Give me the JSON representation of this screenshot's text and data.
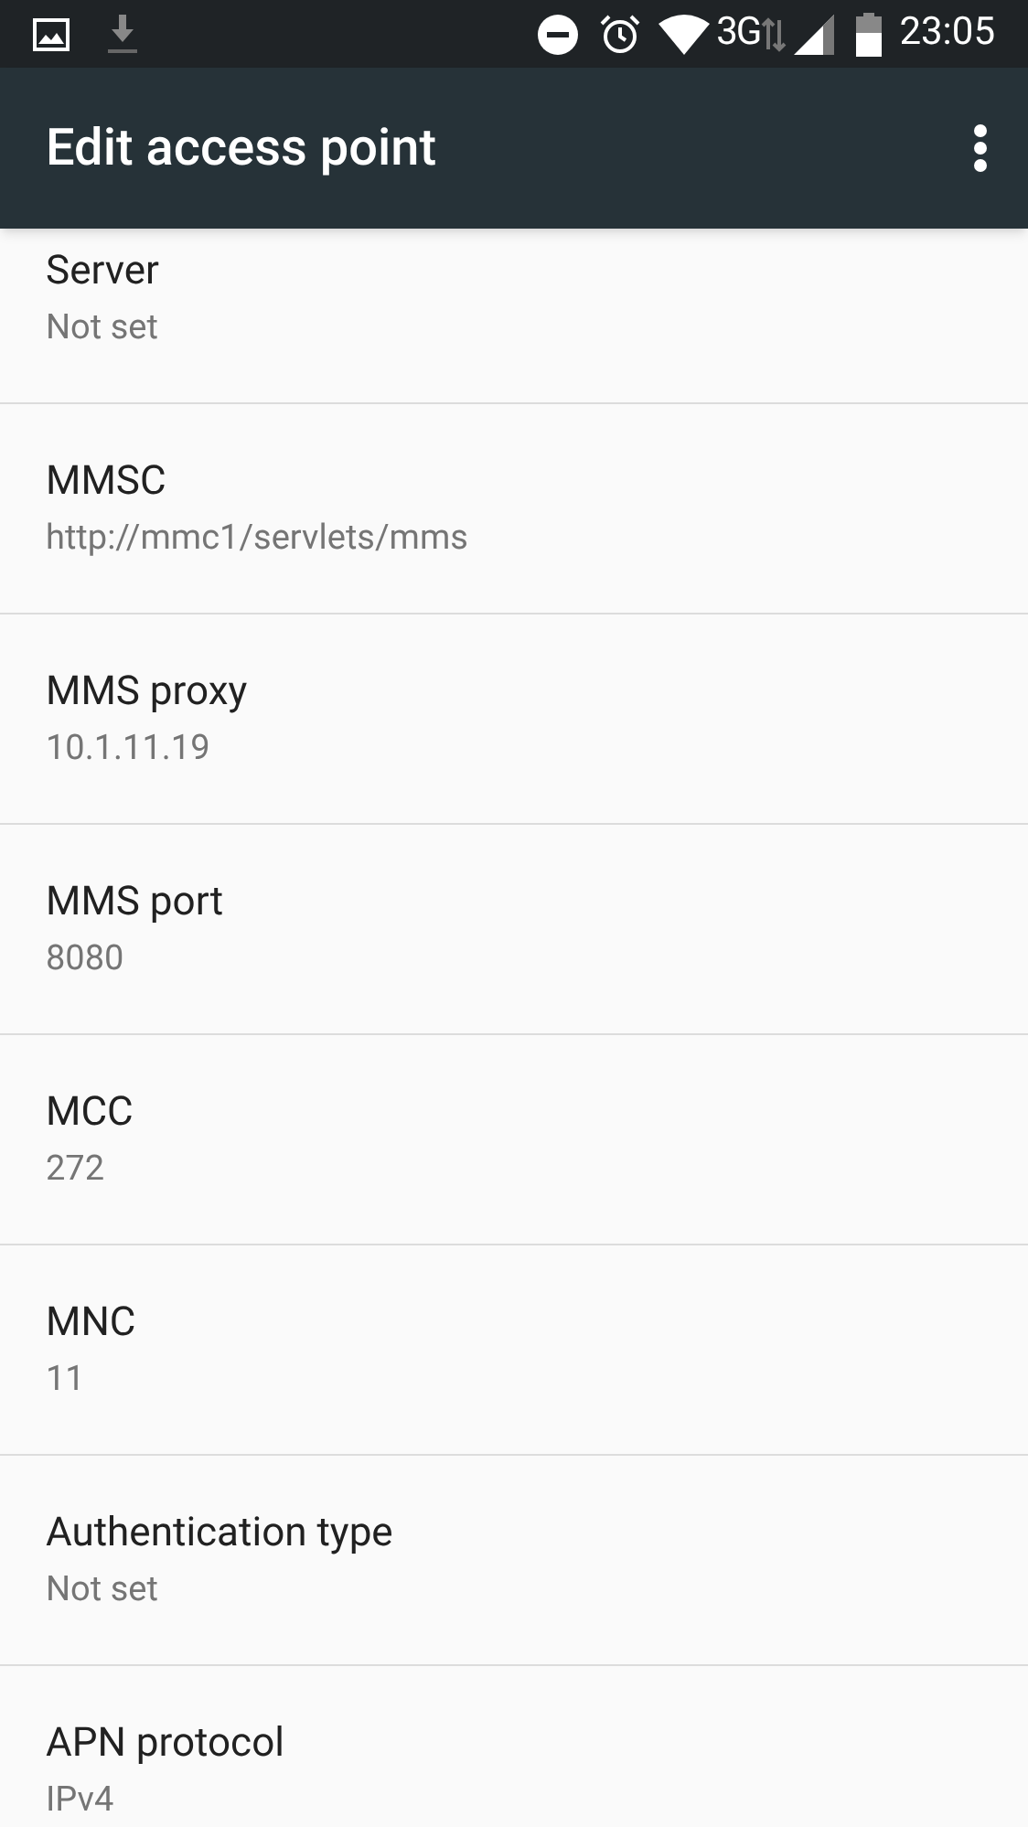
{
  "status_bar": {
    "network": "3G",
    "time": "23:05"
  },
  "app_bar": {
    "title": "Edit access point"
  },
  "settings": [
    {
      "title": "Server",
      "value": "Not set"
    },
    {
      "title": "MMSC",
      "value": "http://mmc1/servlets/mms"
    },
    {
      "title": "MMS proxy",
      "value": "10.1.11.19"
    },
    {
      "title": "MMS port",
      "value": "8080"
    },
    {
      "title": "MCC",
      "value": "272"
    },
    {
      "title": "MNC",
      "value": "11"
    },
    {
      "title": "Authentication type",
      "value": "Not set"
    },
    {
      "title": "APN protocol",
      "value": "IPv4"
    }
  ]
}
